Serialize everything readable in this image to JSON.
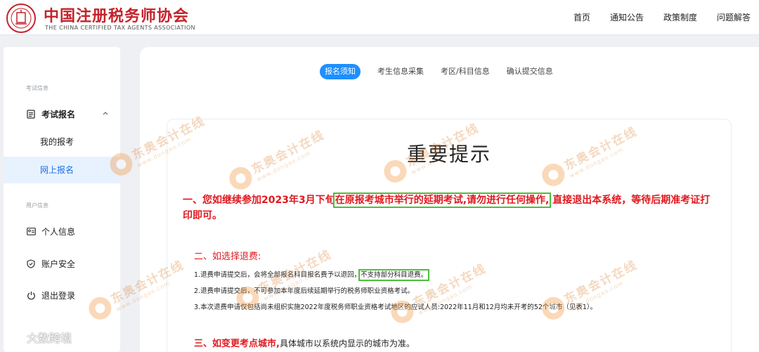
{
  "header": {
    "org_name_cn": "中国注册税务师协会",
    "org_name_en": "THE CHINA CERTIFIED TAX AGENTS ASSOCIATION",
    "nav": [
      "首页",
      "通知公告",
      "政策制度",
      "问题解答"
    ]
  },
  "sidebar": {
    "section1": "考试信息",
    "exam_reg": "考试报名",
    "my_reg": "我的报考",
    "online_reg": "网上报名",
    "section2": "用户信息",
    "personal": "个人信息",
    "security": "账户安全",
    "logout": "退出登录"
  },
  "tabs": [
    "报名须知",
    "考生信息采集",
    "考区/科目信息",
    "确认提交信息"
  ],
  "notice": {
    "title": "重要提示",
    "p1_pre": "一、您如继续参加2023年3月下旬",
    "p1_hl": "在原报考城市举行的延期考试,请勿进行任何操作,",
    "p1_post": " 直接退出本系统，等待后期准考证打印即可。",
    "sec2": "二、如选择退费:",
    "line1_pre": "1.退费申请提交后，会将全部报名科目报名费予以退回，",
    "line1_hl": "不支持部分科目退费。",
    "line2": "2.退费申请提交后，不可参加本年度后续延期举行的税务师职业资格考试。",
    "line3": "3.本次退费申请仅包括尚未组织实施2022年度税务师职业资格考试地区的应试人员:2022年11月和12月均未开考的52个城市（见表1）。",
    "sec3_title": "三、如变更考点城市,",
    "sec3_rest": "具体城市以系统内显示的城市为准。"
  },
  "watermark": {
    "cn": "东奥会计在线",
    "en": "www.dongao.com"
  },
  "corner_watermark": "大数跨境",
  "colors": {
    "brand_red": "#c4232b",
    "accent_blue": "#1f8fff",
    "notice_red": "#e0191f",
    "highlight_green": "#4cbf3a"
  }
}
